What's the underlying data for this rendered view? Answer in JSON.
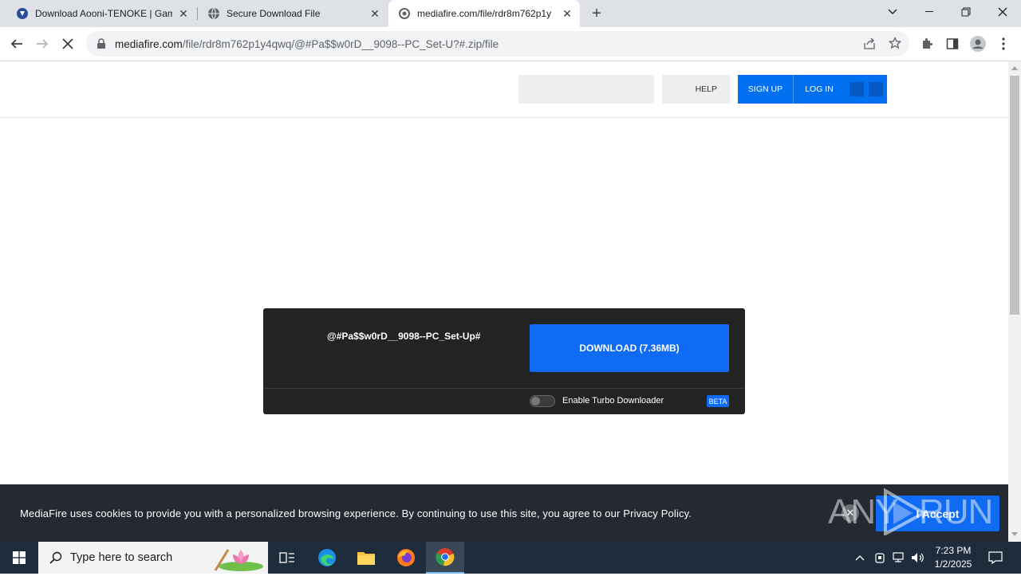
{
  "browser": {
    "tabs": [
      {
        "title": "Download Aooni-TENOKE | Gam",
        "active": false
      },
      {
        "title": "Secure Download File",
        "active": false
      },
      {
        "title": "mediafire.com/file/rdr8m762p1y",
        "active": true
      }
    ],
    "new_tab_symbol": "+",
    "url_host": "mediafire.com",
    "url_path": "/file/rdr8m762p1y4qwq/@#Pa$$w0rD__9098--PC_Set-U?#.zip/file"
  },
  "mediafire": {
    "header": {
      "help_label": "HELP",
      "signup_label": "SIGN UP",
      "login_label": "LOG IN"
    },
    "download_box": {
      "filename": "@#Pa$$w0rD__9098--PC_Set-Up#",
      "download_label": "DOWNLOAD (7.36MB)",
      "turbo_label": "Enable Turbo Downloader",
      "beta_label": "BETA",
      "turbo_enabled": false
    },
    "cookie_banner": {
      "text": "MediaFire uses cookies to provide you with a personalized browsing experience. By continuing to use this site, you agree to our Privacy Policy.",
      "accept_label": "I Accept"
    }
  },
  "watermark": {
    "text_left": "ANY",
    "text_right": "RUN"
  },
  "taskbar": {
    "search_placeholder": "Type here to search",
    "time": "7:23 PM",
    "date": "1/2/2025"
  },
  "colors": {
    "accent_blue": "#0f6af4",
    "dark_panel": "#232323",
    "cookie_bg": "#252932",
    "taskbar_bg": "#1f2c3b"
  }
}
